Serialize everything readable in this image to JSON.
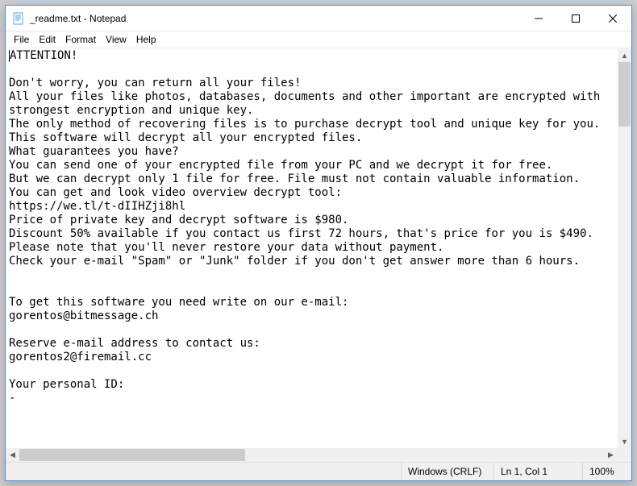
{
  "titlebar": {
    "title": "_readme.txt - Notepad"
  },
  "menu": {
    "file": "File",
    "edit": "Edit",
    "format": "Format",
    "view": "View",
    "help": "Help"
  },
  "document": {
    "lines": [
      "ATTENTION!",
      "",
      "Don't worry, you can return all your files!",
      "All your files like photos, databases, documents and other important are encrypted with strongest encryption and unique key.",
      "The only method of recovering files is to purchase decrypt tool and unique key for you.",
      "This software will decrypt all your encrypted files.",
      "What guarantees you have?",
      "You can send one of your encrypted file from your PC and we decrypt it for free.",
      "But we can decrypt only 1 file for free. File must not contain valuable information.",
      "You can get and look video overview decrypt tool:",
      "https://we.tl/t-dIIHZji8hl",
      "Price of private key and decrypt software is $980.",
      "Discount 50% available if you contact us first 72 hours, that's price for you is $490.",
      "Please note that you'll never restore your data without payment.",
      "Check your e-mail \"Spam\" or \"Junk\" folder if you don't get answer more than 6 hours.",
      "",
      "",
      "To get this software you need write on our e-mail:",
      "gorentos@bitmessage.ch",
      "",
      "Reserve e-mail address to contact us:",
      "gorentos2@firemail.cc",
      "",
      "Your personal ID:",
      "-"
    ]
  },
  "status": {
    "encoding": "Windows (CRLF)",
    "position": "Ln 1, Col 1",
    "zoom": "100%"
  }
}
